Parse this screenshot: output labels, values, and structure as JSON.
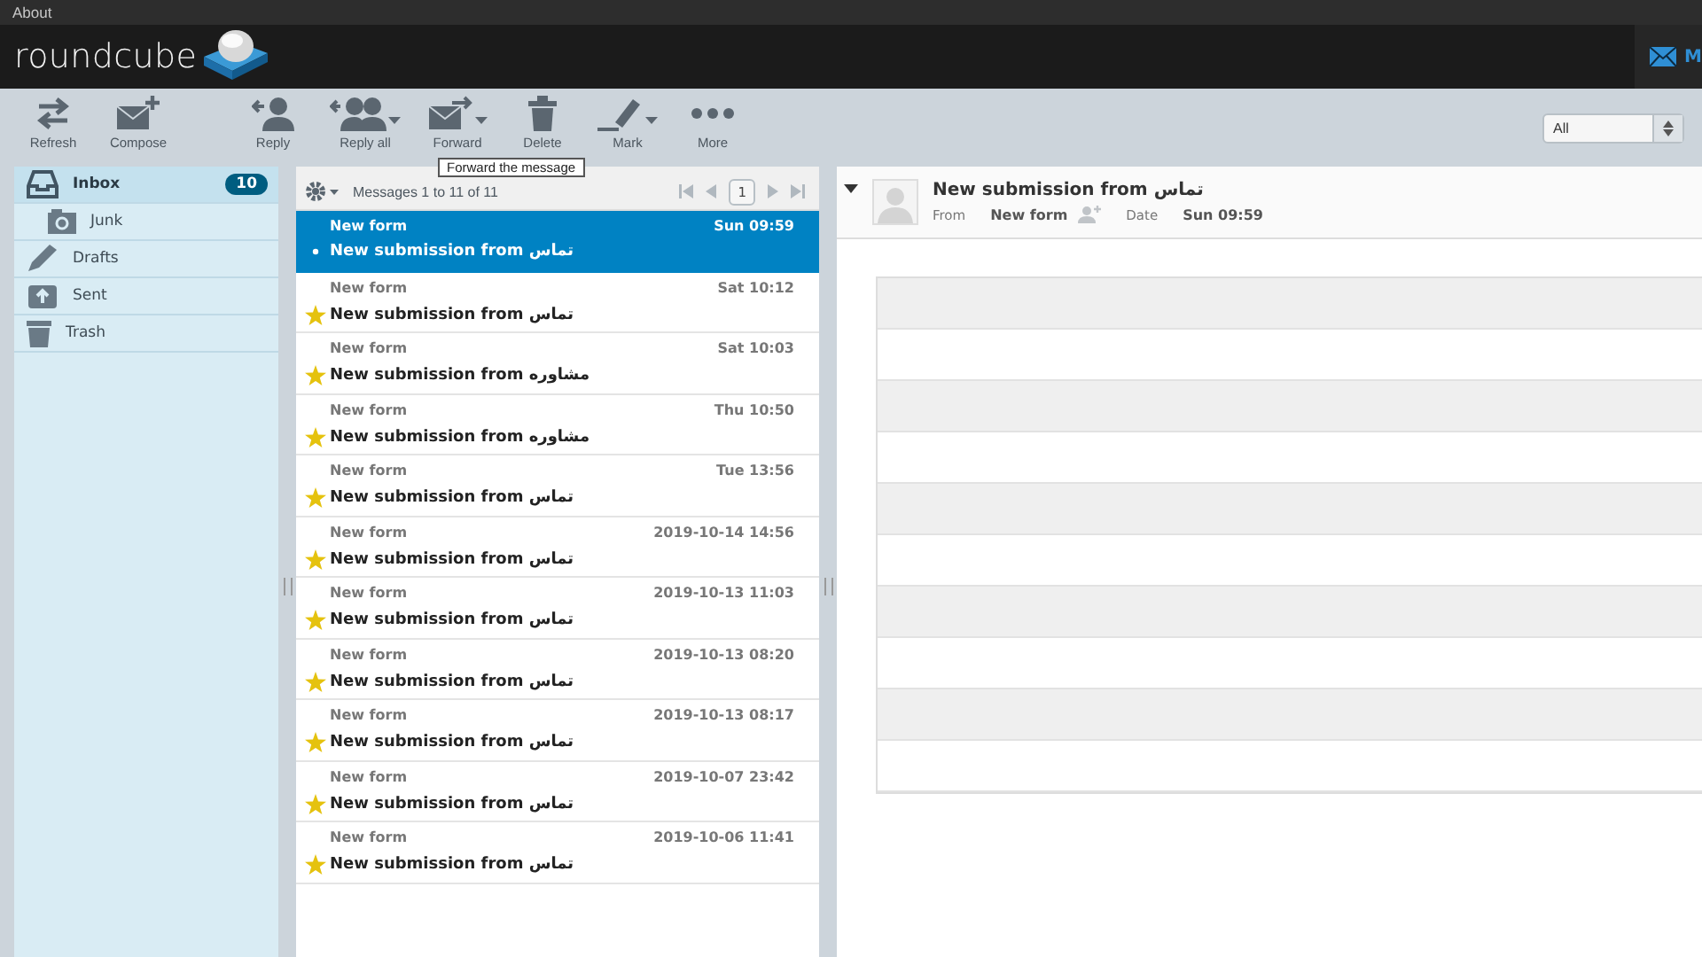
{
  "top_bar": {
    "link": "About"
  },
  "header": {
    "logo": "roundcube",
    "task_label": "M"
  },
  "toolbar": {
    "buttons": [
      {
        "label": "Refresh",
        "kind": "refresh",
        "menu": false
      },
      {
        "label": "Compose",
        "kind": "compose",
        "menu": false
      },
      {
        "label": "Reply",
        "kind": "reply",
        "menu": false
      },
      {
        "label": "Reply all",
        "kind": "replyall",
        "menu": true
      },
      {
        "label": "Forward",
        "kind": "forward",
        "menu": true
      },
      {
        "label": "Delete",
        "kind": "delete",
        "menu": false
      },
      {
        "label": "Mark",
        "kind": "mark",
        "menu": true
      },
      {
        "label": "More",
        "kind": "more",
        "menu": false
      }
    ],
    "tooltip": "Forward the message",
    "filter": {
      "value": "All"
    }
  },
  "folders": [
    {
      "name": "Inbox",
      "kind": "inbox",
      "count": "10",
      "selected": true,
      "children": [
        {
          "name": "Junk",
          "kind": "junk",
          "selected": false
        }
      ]
    },
    {
      "name": "Drafts",
      "kind": "drafts",
      "selected": false
    },
    {
      "name": "Sent",
      "kind": "sent",
      "selected": false
    },
    {
      "name": "Trash",
      "kind": "trash",
      "selected": false
    }
  ],
  "message_list": {
    "summary": "Messages 1 to 11 of 11",
    "page": "1",
    "messages": [
      {
        "from": "New form",
        "date": "Sun 09:59",
        "subject": "New submission from تماس",
        "flagged": false,
        "selected": true
      },
      {
        "from": "New form",
        "date": "Sat 10:12",
        "subject": "New submission from تماس",
        "flagged": true,
        "selected": false
      },
      {
        "from": "New form",
        "date": "Sat 10:03",
        "subject": "New submission from مشاوره",
        "flagged": true,
        "selected": false
      },
      {
        "from": "New form",
        "date": "Thu 10:50",
        "subject": "New submission from مشاوره",
        "flagged": true,
        "selected": false
      },
      {
        "from": "New form",
        "date": "Tue 13:56",
        "subject": "New submission from تماس",
        "flagged": true,
        "selected": false
      },
      {
        "from": "New form",
        "date": "2019-10-14 14:56",
        "subject": "New submission from تماس",
        "flagged": true,
        "selected": false
      },
      {
        "from": "New form",
        "date": "2019-10-13 11:03",
        "subject": "New submission from تماس",
        "flagged": true,
        "selected": false
      },
      {
        "from": "New form",
        "date": "2019-10-13 08:20",
        "subject": "New submission from تماس",
        "flagged": true,
        "selected": false
      },
      {
        "from": "New form",
        "date": "2019-10-13 08:17",
        "subject": "New submission from تماس",
        "flagged": true,
        "selected": false
      },
      {
        "from": "New form",
        "date": "2019-10-07 23:42",
        "subject": "New submission from تماس",
        "flagged": true,
        "selected": false
      },
      {
        "from": "New form",
        "date": "2019-10-06 11:41",
        "subject": "New submission from تماس",
        "flagged": true,
        "selected": false
      }
    ]
  },
  "preview": {
    "subject": "New submission from تماس",
    "from_label": "From",
    "from": "New form",
    "date_label": "Date",
    "date": "Sun 09:59"
  }
}
